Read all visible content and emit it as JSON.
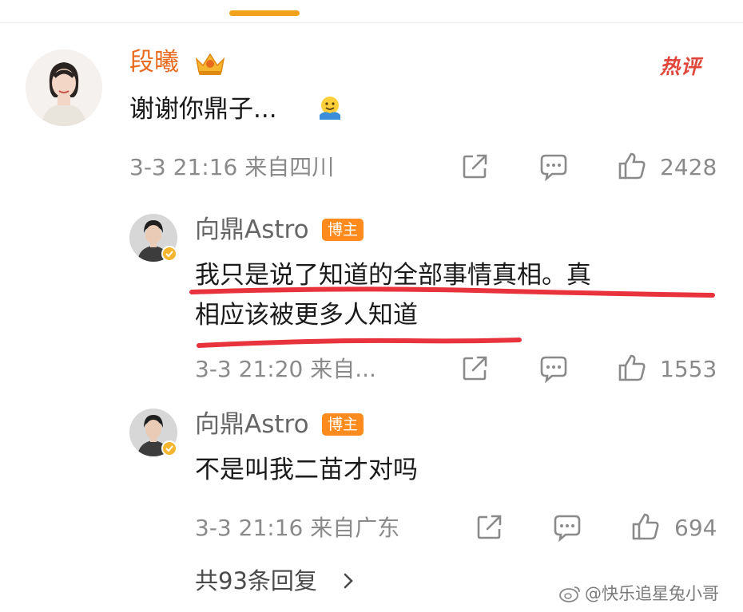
{
  "comment": {
    "username": "段曦",
    "hot_label": "热评",
    "text": "谢谢你鼎子...",
    "timestamp": "3-3 21:16 来自四川",
    "likes": "2428",
    "emoji": "hug-emoji"
  },
  "replies": [
    {
      "username": "向鼎Astro",
      "badge": "博主",
      "text_line1": "我只是说了知道的全部事情真相。真",
      "text_line2": "相应该被更多人知道",
      "timestamp": "3-3 21:20 来自...",
      "likes": "1553"
    },
    {
      "username": "向鼎Astro",
      "badge": "博主",
      "text_line1": "不是叫我二苗才对吗",
      "timestamp": "3-3 21:16 来自广东",
      "likes": "694"
    }
  ],
  "more_replies": "共93条回复",
  "watermark": "@快乐追星兔小哥",
  "colors": {
    "accent_orange": "#ff8a1e",
    "username_orange": "#e86a1e",
    "hot_red": "#e0463a",
    "underline_red": "#e8323c",
    "meta_gray": "#8a8a8a"
  }
}
